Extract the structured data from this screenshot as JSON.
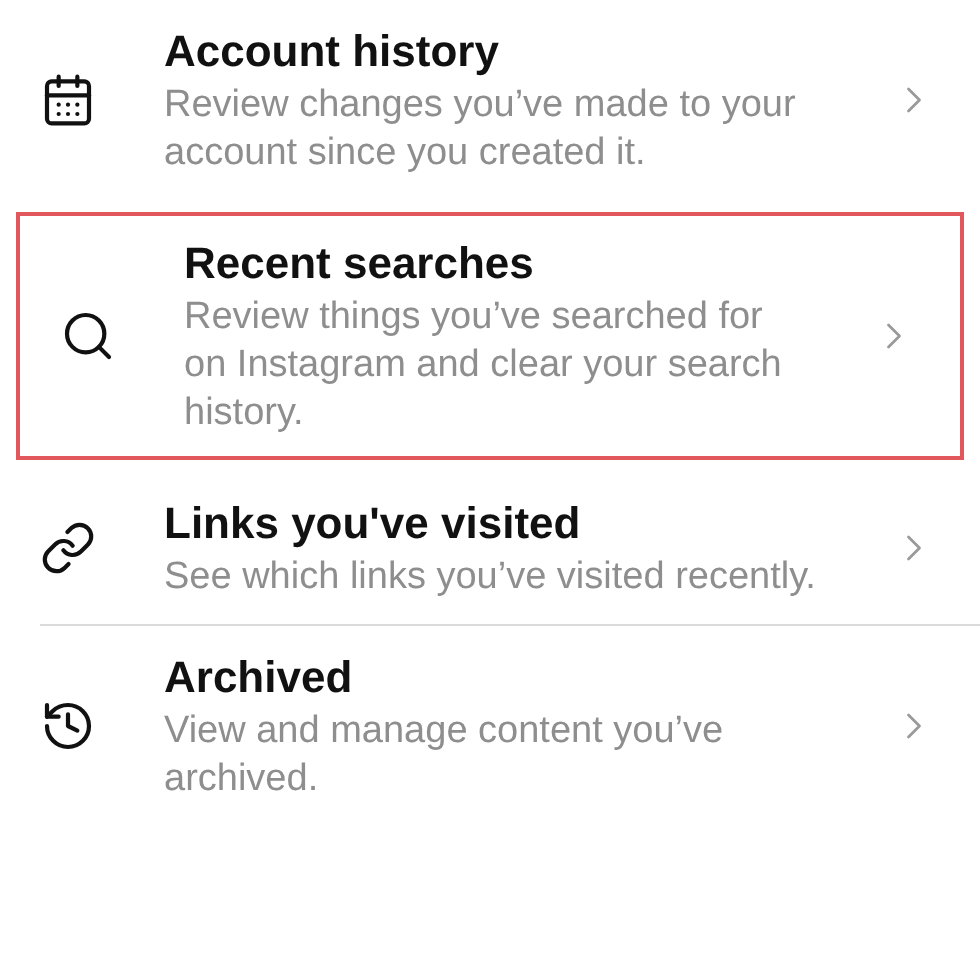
{
  "items": [
    {
      "kind": "calendar",
      "title": "Account history",
      "description": "Review changes you’ve made to your account since you created it.",
      "highlighted": false
    },
    {
      "kind": "search",
      "title": "Recent searches",
      "description": "Review things you’ve searched for on Instagram and clear your search history.",
      "highlighted": true
    },
    {
      "kind": "link",
      "title": "Links you've visited",
      "description": "See which links you’ve visited recently.",
      "highlighted": false
    },
    {
      "kind": "history",
      "title": "Archived",
      "description": "View and manage content you’ve archived.",
      "highlighted": false
    }
  ]
}
